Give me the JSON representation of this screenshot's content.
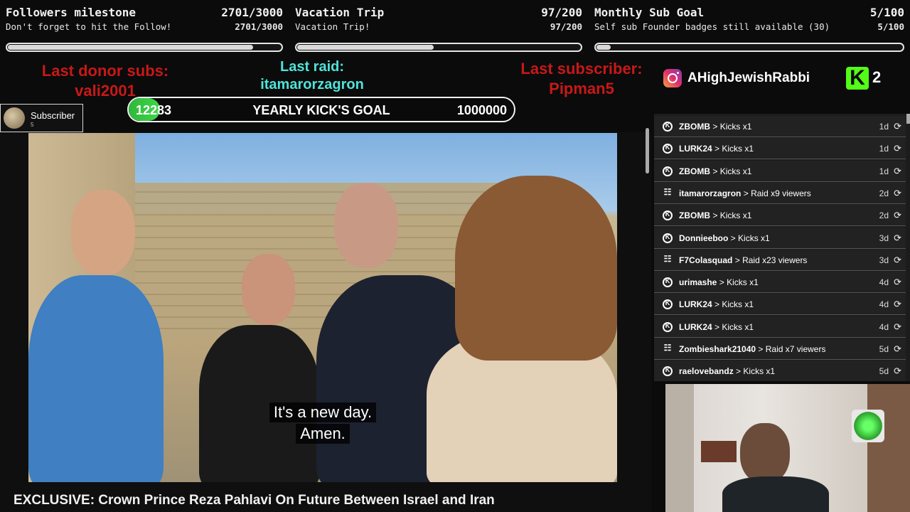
{
  "goals": [
    {
      "title": "Followers milestone",
      "count": "2701/3000",
      "subtitle": "Don't forget to hit the Follow!",
      "count2": "2701/3000",
      "progress": 0.9
    },
    {
      "title": "Vacation Trip",
      "count": "97/200",
      "subtitle": "Vacation Trip!",
      "count2": "97/200",
      "progress": 0.485
    },
    {
      "title": "Monthly Sub Goal",
      "count": "5/100",
      "subtitle": "Self sub Founder badges still available (30)",
      "count2": "5/100",
      "progress": 0.05
    }
  ],
  "last_donor": {
    "label": "Last donor subs:",
    "value": "vali2001"
  },
  "last_raid": {
    "label": "Last raid:",
    "value": "itamarorzagron"
  },
  "last_subscriber": {
    "label": "Last subscriber:",
    "value": "Pipman5"
  },
  "instagram": {
    "handle": "AHighJewishRabbi",
    "icon": "instagram-icon"
  },
  "kick": {
    "logo": "K",
    "count": "2",
    "icon": "kick-logo-icon"
  },
  "yearly_goal": {
    "current": "12283",
    "label": "YEARLY KICK'S GOAL",
    "target": "1000000"
  },
  "subscriber_badge": {
    "label": "Subscriber",
    "small": "5"
  },
  "video": {
    "subtitle_line1": "It's a new day.",
    "subtitle_line2": "Amen.",
    "title": "EXCLUSIVE: Crown Prince Reza Pahlavi On Future Between Israel and Iran"
  },
  "feed": [
    {
      "user": "ZBOMB",
      "action": "Kicks x1",
      "time": "1d",
      "type": "kick"
    },
    {
      "user": "LURK24",
      "action": "Kicks x1",
      "time": "1d",
      "type": "kick"
    },
    {
      "user": "ZBOMB",
      "action": "Kicks x1",
      "time": "1d",
      "type": "kick"
    },
    {
      "user": "itamarorzagron",
      "action": "Raid x9 viewers",
      "time": "2d",
      "type": "raid"
    },
    {
      "user": "ZBOMB",
      "action": "Kicks x1",
      "time": "2d",
      "type": "kick"
    },
    {
      "user": "Donnieeboo",
      "action": "Kicks x1",
      "time": "3d",
      "type": "kick"
    },
    {
      "user": "F7Colasquad",
      "action": "Raid x23 viewers",
      "time": "3d",
      "type": "raid"
    },
    {
      "user": "urimashe",
      "action": "Kicks x1",
      "time": "4d",
      "type": "kick"
    },
    {
      "user": "LURK24",
      "action": "Kicks x1",
      "time": "4d",
      "type": "kick"
    },
    {
      "user": "LURK24",
      "action": "Kicks x1",
      "time": "4d",
      "type": "kick"
    },
    {
      "user": "Zombieshark21040",
      "action": "Raid x7 viewers",
      "time": "5d",
      "type": "raid"
    },
    {
      "user": "raelovebandz",
      "action": "Kicks x1",
      "time": "5d",
      "type": "kick"
    }
  ],
  "feed_separator": ">",
  "replay_glyph": "⟳"
}
